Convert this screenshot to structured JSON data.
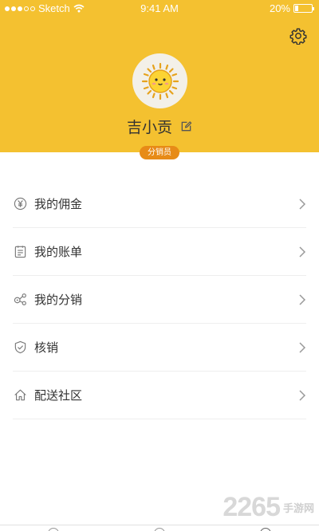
{
  "status_bar": {
    "carrier": "Sketch",
    "time": "9:41 AM",
    "battery": "20%"
  },
  "header": {
    "user_name": "吉小贡",
    "role_badge": "分销员"
  },
  "menu": {
    "items": [
      {
        "label": "我的佣金",
        "icon": "yen-circle-icon"
      },
      {
        "label": "我的账单",
        "icon": "bill-icon"
      },
      {
        "label": "我的分销",
        "icon": "distribution-icon"
      },
      {
        "label": "核销",
        "icon": "shield-check-icon"
      },
      {
        "label": "配送社区",
        "icon": "home-icon"
      }
    ]
  },
  "watermark": {
    "number": "2265",
    "text": "手游网"
  },
  "colors": {
    "header_bg": "#f4c130",
    "badge_bg": "#e78b17"
  }
}
